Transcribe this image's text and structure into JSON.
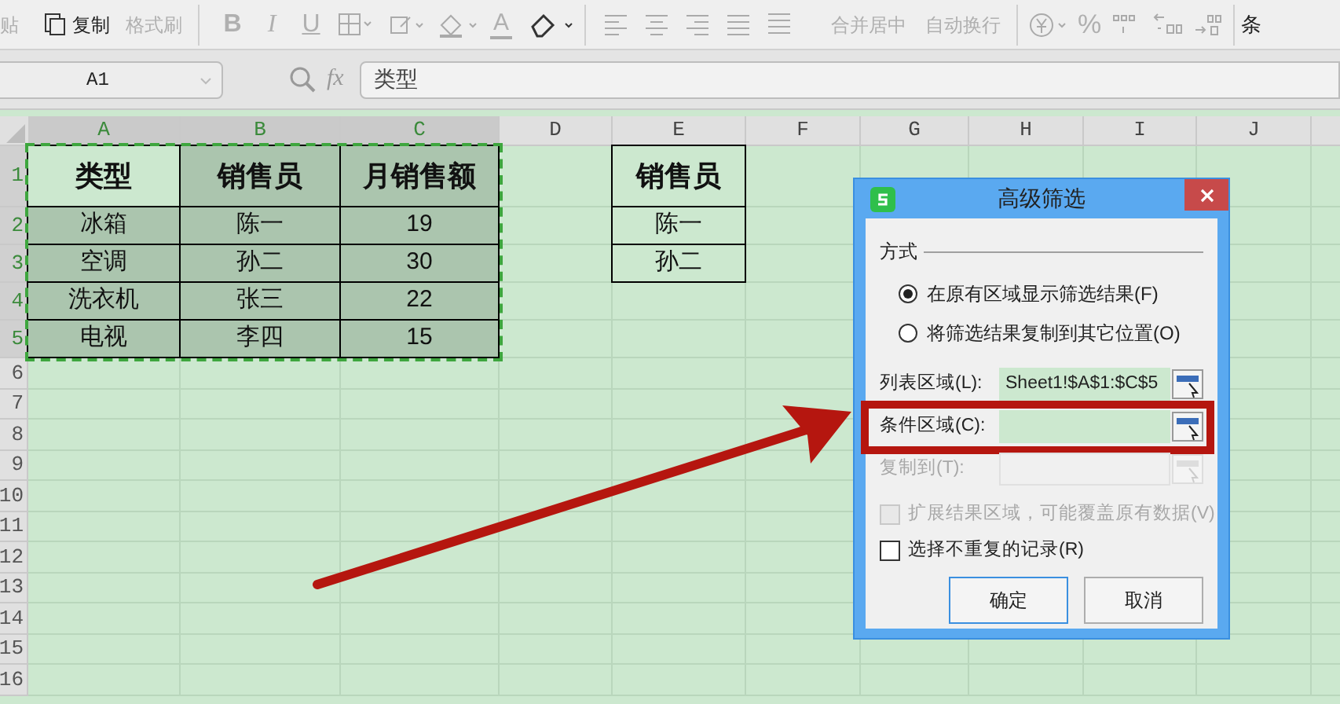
{
  "toolbar": {
    "clipboard": [
      {
        "label": "贴",
        "disabled": true
      },
      {
        "label": "复制",
        "disabled": false
      },
      {
        "label": "格式刷",
        "disabled": true
      }
    ],
    "font_styles": [
      {
        "label": "B",
        "disabled": true
      },
      {
        "label": "I",
        "disabled": true
      },
      {
        "label": "U",
        "disabled": true
      }
    ],
    "font_color": {
      "label": "A",
      "disabled": true
    },
    "alignment": [
      {
        "label": "合并居中",
        "disabled": true
      },
      {
        "label": "自动换行",
        "disabled": true
      }
    ],
    "number": [
      {
        "label": "%",
        "disabled": true
      }
    ],
    "cut_item": {
      "label": "条"
    }
  },
  "formula_bar": {
    "name_box": "A1",
    "fx": "fx",
    "value": "类型"
  },
  "sheet": {
    "columns": [
      {
        "label": "A",
        "selected": true
      },
      {
        "label": "B",
        "selected": true
      },
      {
        "label": "C",
        "selected": true
      },
      {
        "label": "D",
        "selected": false
      },
      {
        "label": "E",
        "selected": false
      },
      {
        "label": "F",
        "selected": false
      },
      {
        "label": "G",
        "selected": false
      },
      {
        "label": "H",
        "selected": false
      },
      {
        "label": "I",
        "selected": false
      },
      {
        "label": "J",
        "selected": false
      }
    ],
    "row_numbers": [
      {
        "label": "1",
        "selected": true
      },
      {
        "label": "2",
        "selected": true
      },
      {
        "label": "3",
        "selected": true
      },
      {
        "label": "4",
        "selected": true
      },
      {
        "label": "5",
        "selected": true
      },
      {
        "label": "6",
        "selected": false
      },
      {
        "label": "7",
        "selected": false
      },
      {
        "label": "8",
        "selected": false
      },
      {
        "label": "9",
        "selected": false
      },
      {
        "label": "10",
        "selected": false
      },
      {
        "label": "11",
        "selected": false
      },
      {
        "label": "12",
        "selected": false
      },
      {
        "label": "13",
        "selected": false
      },
      {
        "label": "14",
        "selected": false
      },
      {
        "label": "15",
        "selected": false
      },
      {
        "label": "16",
        "selected": false
      }
    ],
    "data_table": {
      "columns": [
        "类型",
        "销售员",
        "月销售额"
      ],
      "rows": [
        [
          "冰箱",
          "陈一",
          "19"
        ],
        [
          "空调",
          "孙二",
          "30"
        ],
        [
          "洗衣机",
          "张三",
          "22"
        ],
        [
          "电视",
          "李四",
          "15"
        ]
      ]
    },
    "criteria_table": {
      "columns": [
        "销售员"
      ],
      "rows": [
        [
          "陈一"
        ],
        [
          "孙二"
        ]
      ]
    }
  },
  "dialog": {
    "title": "高级筛选",
    "section": "方式",
    "options": [
      {
        "label": "在原有区域显示筛选结果(F)",
        "selected": true
      },
      {
        "label": "将筛选结果复制到其它位置(O)",
        "selected": false
      }
    ],
    "fields": [
      {
        "label": "列表区域(L):",
        "value": "Sheet1!$A$1:$C$5",
        "disabled": false,
        "highlighted": false
      },
      {
        "label": "条件区域(C):",
        "disabled": false,
        "highlighted": true
      },
      {
        "label": "复制到(T):",
        "disabled": true,
        "highlighted": false
      }
    ],
    "checkboxes": [
      {
        "label": "扩展结果区域，可能覆盖原有数据(V)",
        "checked": false,
        "disabled": true
      },
      {
        "label": "选择不重复的记录(R)",
        "checked": false,
        "disabled": false
      }
    ],
    "buttons": [
      {
        "label": "确定",
        "focused": true
      },
      {
        "label": "取消",
        "focused": false
      }
    ]
  }
}
